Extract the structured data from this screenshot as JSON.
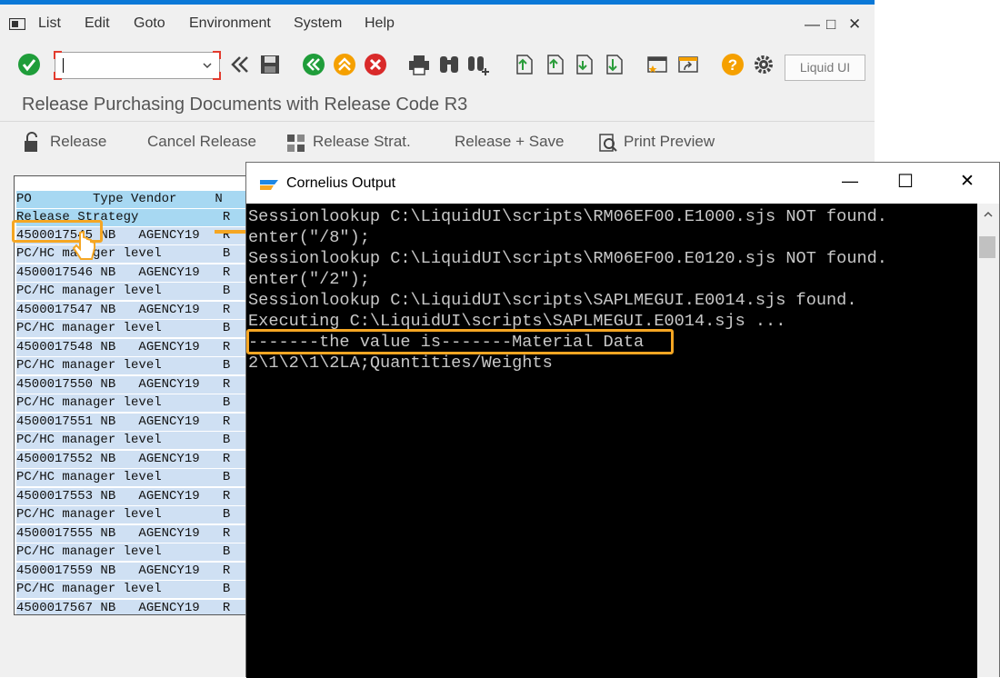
{
  "menu": {
    "items": [
      "List",
      "Edit",
      "Goto",
      "Environment",
      "System",
      "Help"
    ],
    "window_controls": [
      "—",
      "□",
      "✕"
    ]
  },
  "toolbar": {
    "command_field_value": "",
    "liquid_ui_label": "Liquid UI",
    "icons": [
      "enter-icon",
      "back-icon",
      "save-icon",
      "back-green-icon",
      "exit-icon",
      "cancel-icon",
      "print-icon",
      "find-icon",
      "find-next-icon",
      "first-page-icon",
      "prev-page-icon",
      "next-page-icon",
      "last-page-icon",
      "create-session-icon",
      "shortcut-icon",
      "help-icon",
      "settings-icon"
    ]
  },
  "page": {
    "title": "Release Purchasing Documents with Release Code R3"
  },
  "actions": {
    "release": "Release",
    "cancel_release": "Cancel Release",
    "release_strat": "Release Strat.",
    "release_save": "Release + Save",
    "print_preview": "Print Preview"
  },
  "table": {
    "header": "PO        Type Vendor     N",
    "subheader": "Release Strategy           R",
    "rows": [
      "4500017545 NB   AGENCY19   R",
      "PC/HC manager level        B",
      "4500017546 NB   AGENCY19   R",
      "PC/HC manager level        B",
      "4500017547 NB   AGENCY19   R",
      "PC/HC manager level        B",
      "4500017548 NB   AGENCY19   R",
      "PC/HC manager level        B",
      "4500017550 NB   AGENCY19   R",
      "PC/HC manager level        B",
      "4500017551 NB   AGENCY19   R",
      "PC/HC manager level        B",
      "4500017552 NB   AGENCY19   R",
      "PC/HC manager level        B",
      "4500017553 NB   AGENCY19   R",
      "PC/HC manager level        B",
      "4500017555 NB   AGENCY19   R",
      "PC/HC manager level        B",
      "4500017559 NB   AGENCY19   R",
      "PC/HC manager level        B",
      "4500017567 NB   AGENCY19   R"
    ]
  },
  "cornelius": {
    "title": "Cornelius Output",
    "controls": [
      "—",
      "☐",
      "✕"
    ],
    "lines": [
      "Sessionlookup C:\\LiquidUI\\scripts\\RM06EF00.E1000.sjs NOT found.",
      "enter(\"/8\");",
      "Sessionlookup C:\\LiquidUI\\scripts\\RM06EF00.E0120.sjs NOT found.",
      "enter(\"/2\");",
      "Sessionlookup C:\\LiquidUI\\scripts\\SAPLMEGUI.E0014.sjs found.",
      "Executing C:\\LiquidUI\\scripts\\SAPLMEGUI.E0014.sjs ...",
      "-------the value is-------Material Data",
      "2\\1\\2\\1\\2LA;Quantities/Weights"
    ]
  },
  "colors": {
    "highlight": "#f5a623",
    "table_header": "#a7d8f2",
    "row_shade": "#cfe0f3",
    "console_bg": "#000000",
    "console_text": "#c8c8c8",
    "top_accent": "#0a78d7"
  }
}
